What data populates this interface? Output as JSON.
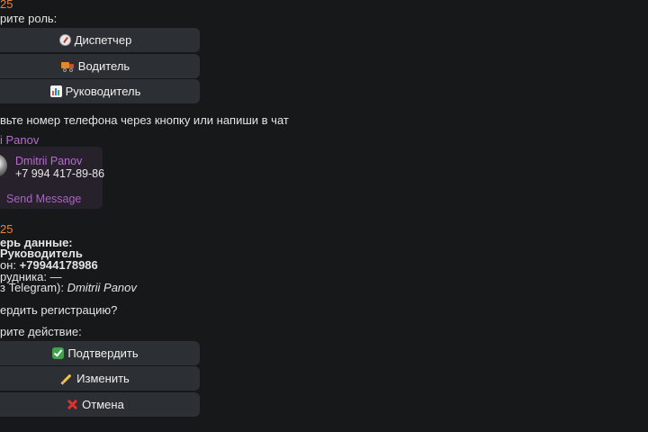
{
  "msg1": {
    "time": "25",
    "prompt": "рите роль:"
  },
  "role_buttons": [
    {
      "icon": "compass-icon",
      "label": "Диспетчер"
    },
    {
      "icon": "truck-icon",
      "label": "Водитель"
    },
    {
      "icon": "bar-chart-icon",
      "label": "Руководитель"
    }
  ],
  "phone_prompt": "вьте номер телефона через кнопку или напиши в чат",
  "contact_msg": {
    "sender": "i Panov",
    "contact_name": "Dmitrii Panov",
    "contact_phone": "+7 994 417-89-86",
    "send_label": "Send Message"
  },
  "msg2": {
    "time": "25",
    "check_header": "ерь данные:",
    "role_value": "Руководитель",
    "phone_prefix": "он: ",
    "phone_value": "+79944178986",
    "employee_prefix": "рудника: ",
    "employee_value": "—",
    "telegram_prefix": "з Telegram): ",
    "telegram_value": "Dmitrii Panov",
    "confirm_question": "ердить регистрацию?",
    "action_prompt": "рите действие:"
  },
  "action_buttons": [
    {
      "icon": "check-icon",
      "label": "Подтвердить"
    },
    {
      "icon": "pencil-icon",
      "label": "Изменить"
    },
    {
      "icon": "cross-icon",
      "label": "Отмена"
    }
  ],
  "colors": {
    "background": "#17181a",
    "button": "#2c2f33",
    "accent_orange": "#e8813a",
    "accent_purple": "#b86bd0",
    "contact_card": "#26212b"
  }
}
